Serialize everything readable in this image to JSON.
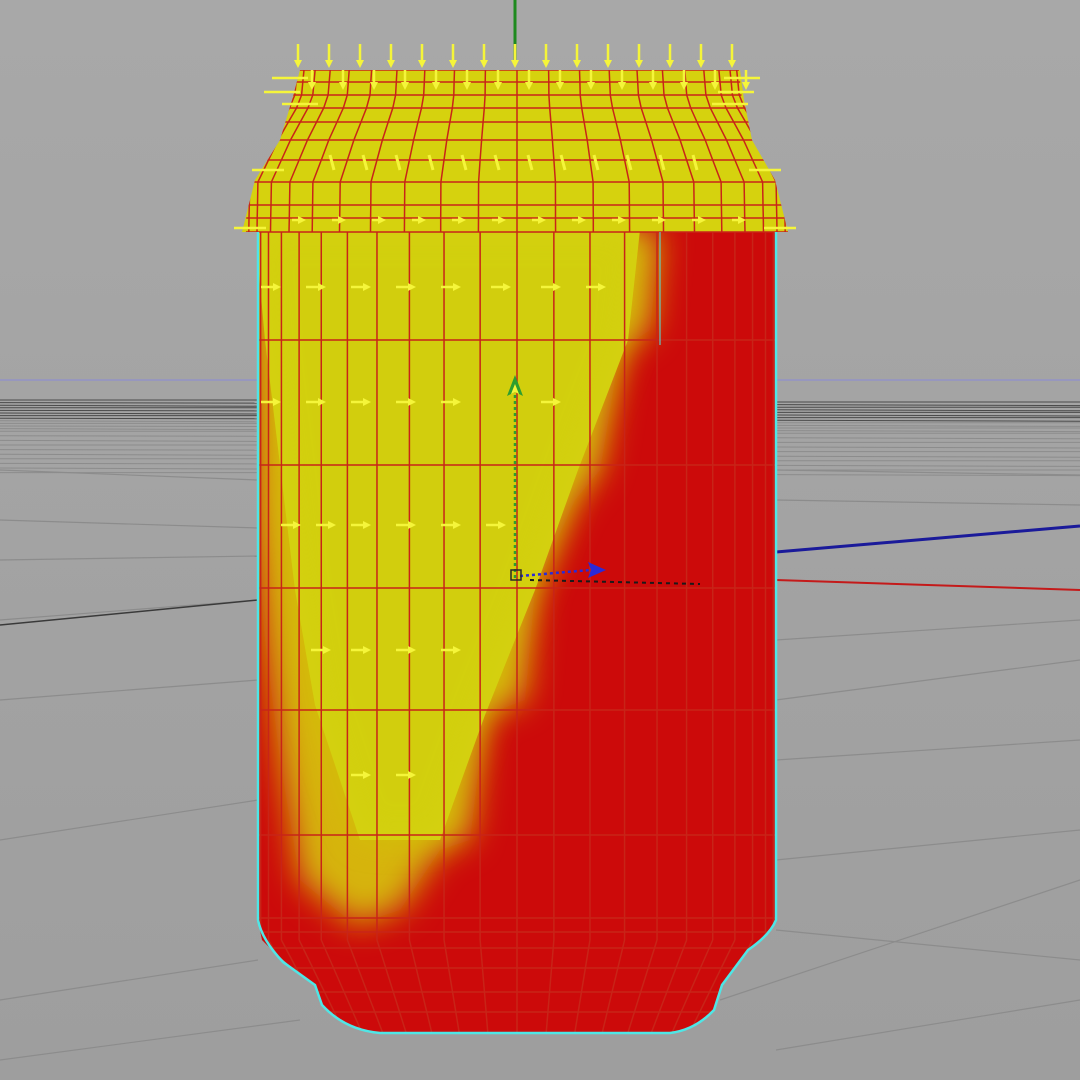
{
  "viewport": {
    "background": "#a3a3a3",
    "grid_color": "#8c8c8c",
    "grid_dark_color": "#4a4a4a",
    "horizon_color": "#8a8ad8",
    "mesh_edge_color": "#c82418",
    "border_edge_color": "#4fe6e6",
    "paint_color_high": "#d6d20e",
    "paint_color_low": "#cc0a0a",
    "normal_arrow_color": "#f5f53a"
  },
  "object": {
    "name": "can-mesh",
    "mesh_columns": 22
  },
  "manipulator": {
    "y_axis_color": "#2e9e2e",
    "x_axis_color": "#2a2ad8",
    "z_axis_color": "#1a1a1a",
    "pivot_icon": "pivot-icon"
  },
  "world_axes": {
    "x_color": "#c41a1a",
    "z_color": "#1a1a9a",
    "y_color": "#1e8a1e"
  }
}
